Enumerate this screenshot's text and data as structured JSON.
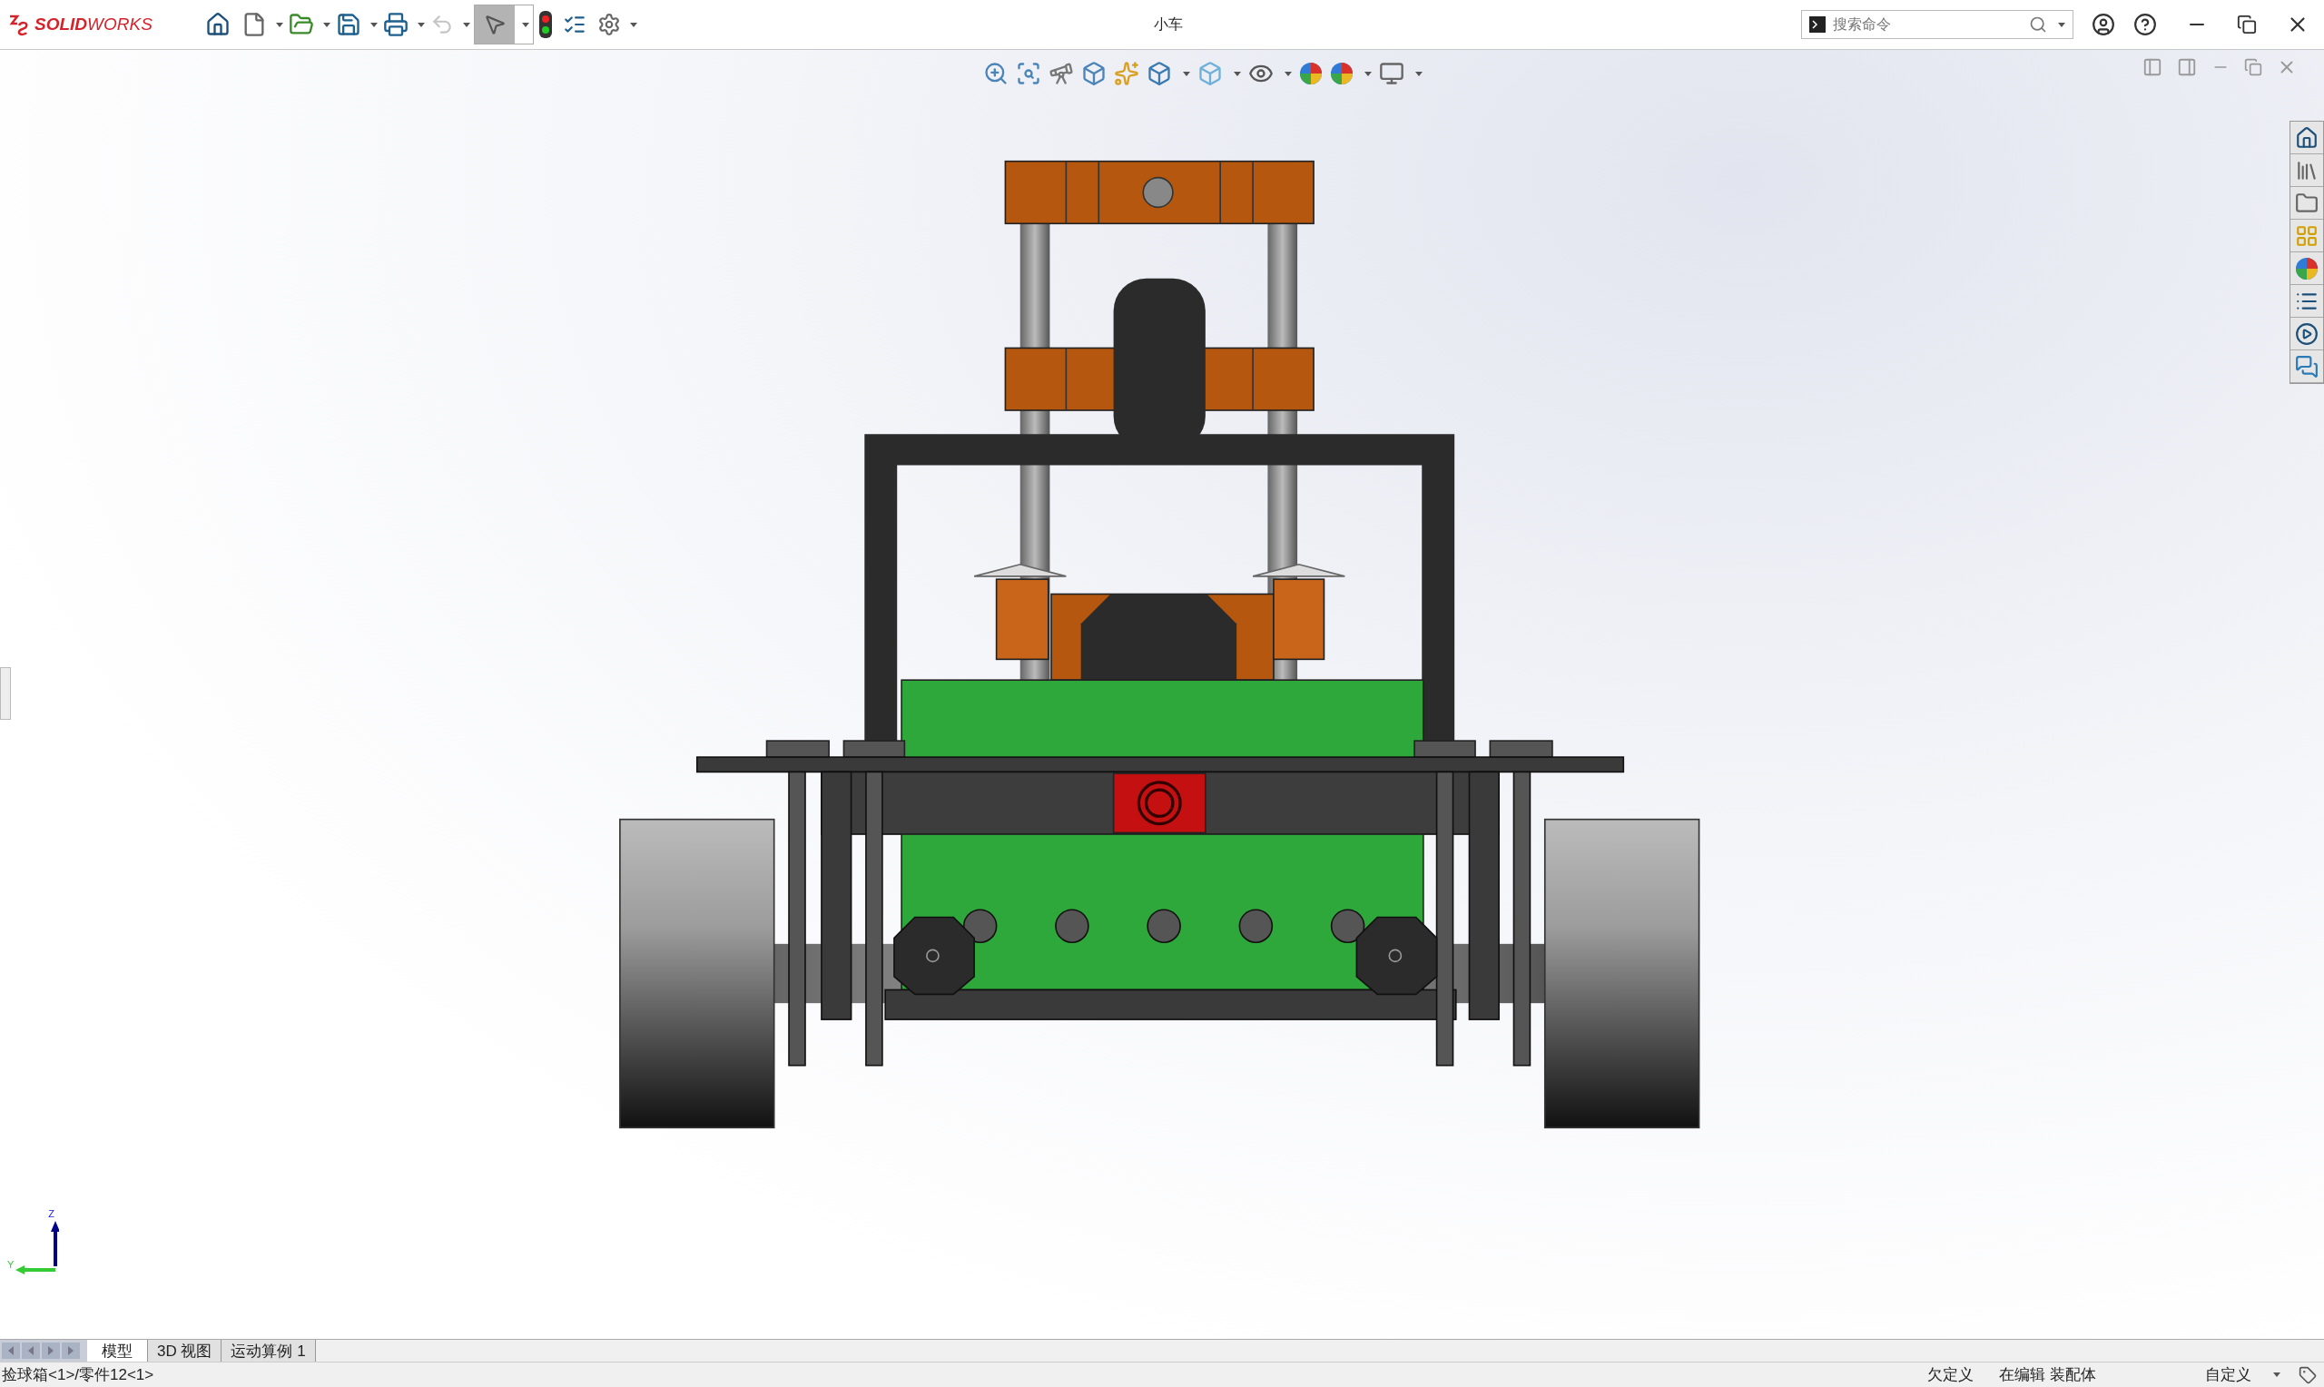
{
  "title_bar": {
    "logo": "**SOLID**WORKS",
    "title": "小车",
    "search": {
      "placeholder": "搜索命令"
    },
    "select_tool": {
      "selected": true
    },
    "undo": {
      "disabled": true
    }
  },
  "triad": {
    "z_label": "Z",
    "y_label": "Y"
  },
  "tabs": [
    {
      "label": "模型",
      "selected": true
    },
    {
      "label": "3D 视图",
      "selected": false
    },
    {
      "label": "运动算例 1",
      "selected": false
    }
  ],
  "status_bar": {
    "path": "捡球箱<1>/零件12<1>",
    "definition": "欠定义",
    "editing": "在编辑 装配体",
    "units": "自定义"
  }
}
